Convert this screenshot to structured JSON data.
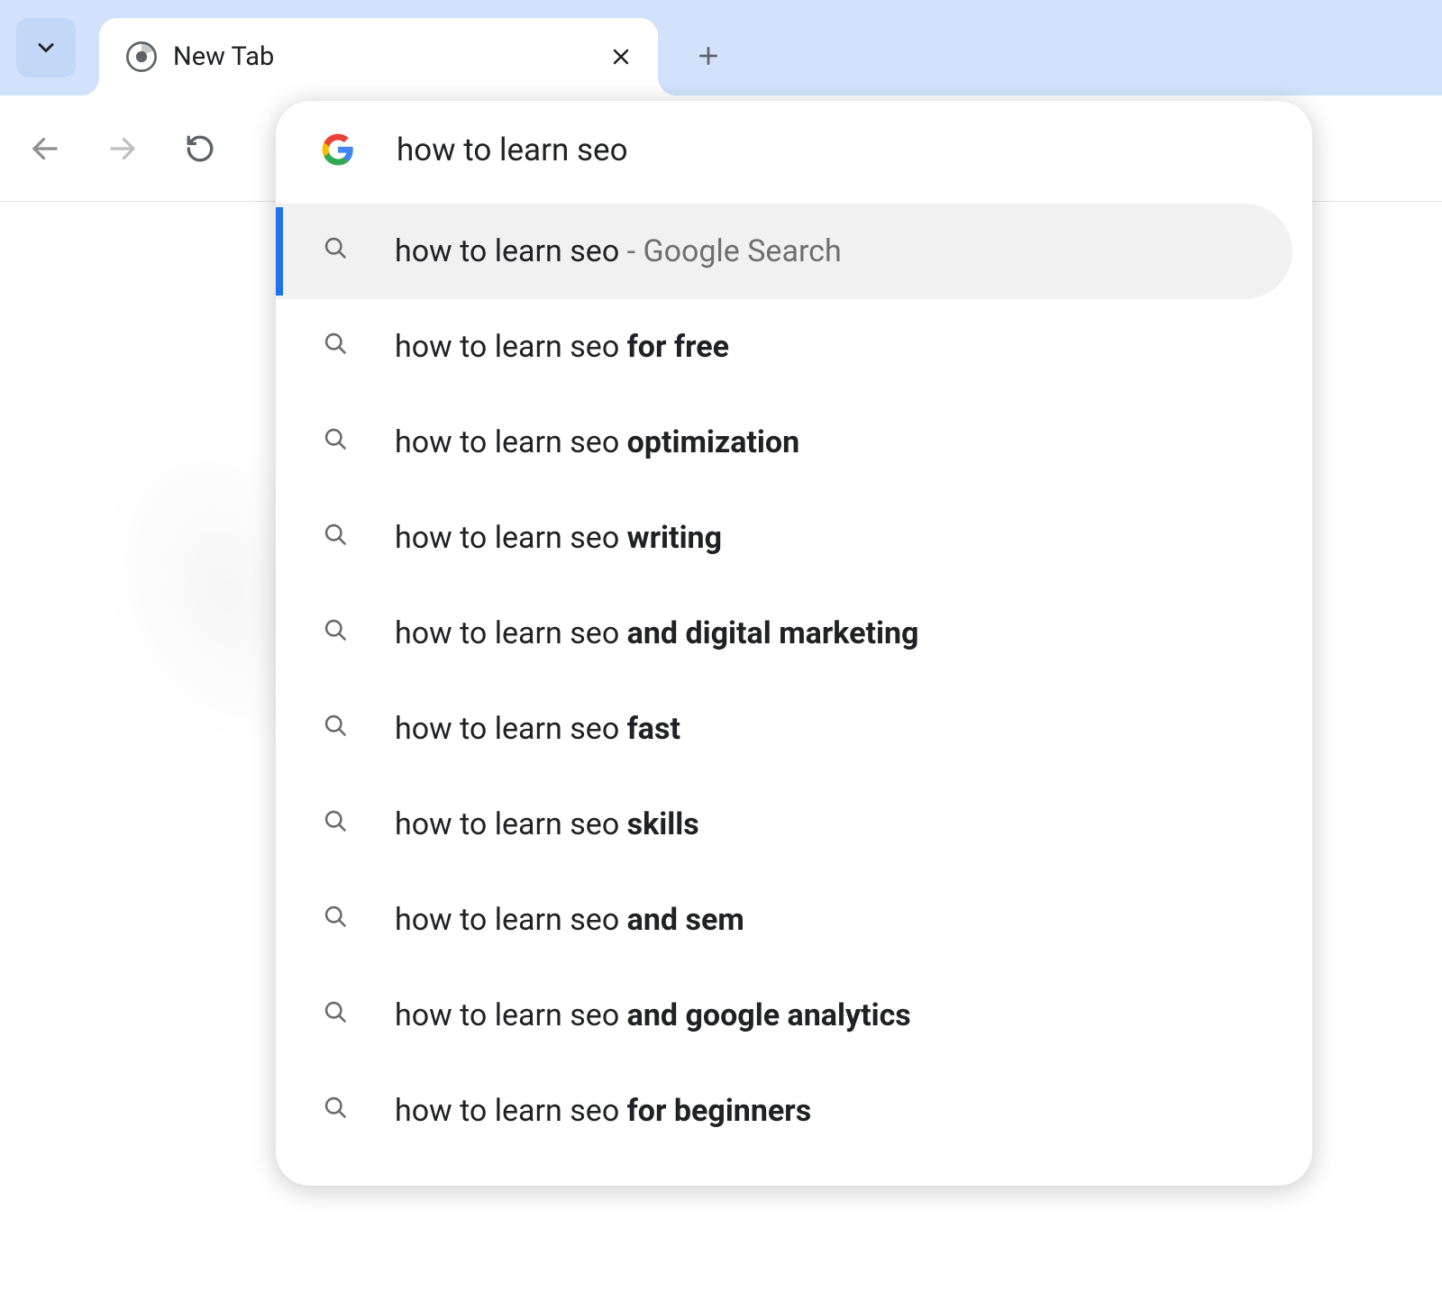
{
  "tab": {
    "title": "New Tab"
  },
  "omnibox": {
    "query": "how to learn seo"
  },
  "suggestions": [
    {
      "prefix": "how to learn seo",
      "bold": "",
      "annotation": " - Google Search",
      "selected": true
    },
    {
      "prefix": "how to learn seo ",
      "bold": "for free",
      "annotation": "",
      "selected": false
    },
    {
      "prefix": "how to learn seo ",
      "bold": "optimization",
      "annotation": "",
      "selected": false
    },
    {
      "prefix": "how to learn seo ",
      "bold": "writing",
      "annotation": "",
      "selected": false
    },
    {
      "prefix": "how to learn seo ",
      "bold": "and digital marketing",
      "annotation": "",
      "selected": false
    },
    {
      "prefix": "how to learn seo ",
      "bold": "fast",
      "annotation": "",
      "selected": false
    },
    {
      "prefix": "how to learn seo ",
      "bold": "skills",
      "annotation": "",
      "selected": false
    },
    {
      "prefix": "how to learn seo ",
      "bold": "and sem",
      "annotation": "",
      "selected": false
    },
    {
      "prefix": "how to learn seo ",
      "bold": "and google analytics",
      "annotation": "",
      "selected": false
    },
    {
      "prefix": "how to learn seo ",
      "bold": "for beginners",
      "annotation": "",
      "selected": false
    }
  ]
}
